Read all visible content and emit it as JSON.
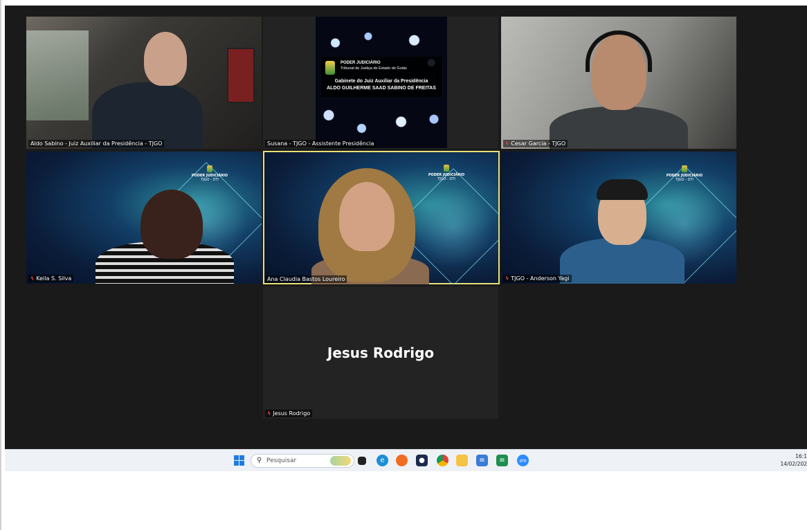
{
  "participants": [
    {
      "name": "Aldo Sabino - Juiz Auxiliar da Presidência - TJGO",
      "muted": false
    },
    {
      "name": "Susana - TJGO - Assistente Presidência",
      "muted": false
    },
    {
      "name": "Cesar Garcia - TJGO",
      "muted": true
    },
    {
      "name": "Keila S. Silva",
      "muted": true
    },
    {
      "name": "Ana Claudia Bastos Loureiro",
      "muted": false
    },
    {
      "name": "TJGO - Anderson Yagi",
      "muted": true
    },
    {
      "name": "Jesus Rodrigo",
      "muted": true
    }
  ],
  "share_card": {
    "org": "PODER JUDICIÁRIO",
    "court": "Tribunal de Justiça do Estado de Goiás",
    "office": "Gabinete do Juiz Auxiliar da Presidência",
    "judge": "ALDO GUILHERME SAAD SABINO DE FREITAS"
  },
  "background_logo": {
    "org": "PODER JUDICIÁRIO",
    "sub": "TJGO - DTI"
  },
  "no_video_display_name": "Jesus Rodrigo",
  "taskbar": {
    "search_placeholder": "Pesquisar",
    "clock_time": "16:1",
    "clock_date": "14/02/202"
  },
  "colors": {
    "active_speaker_border": "#e8e07a",
    "muted_icon": "#e0433a",
    "window_bg": "#1a1a1a"
  }
}
